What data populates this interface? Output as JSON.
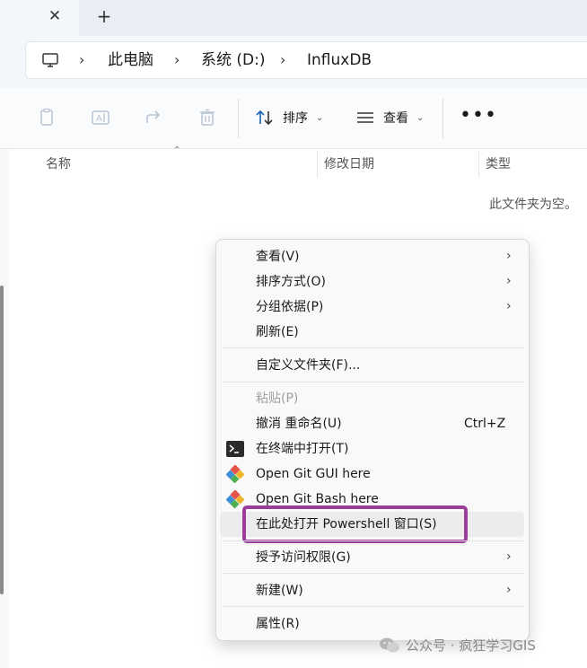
{
  "tabs": {
    "close_glyph": "✕",
    "new_tab_glyph": "+"
  },
  "address": {
    "icon": "this-pc-icon",
    "separator": "›",
    "crumbs": [
      "此电脑",
      "系统 (D:)",
      "InfluxDB"
    ]
  },
  "command_bar": {
    "icons": [
      "copy-icon",
      "rename-icon",
      "share-icon",
      "delete-icon"
    ],
    "sort_label": "排序",
    "view_label": "查看",
    "more_glyph": "•••",
    "caret": "⌄"
  },
  "columns": {
    "name": "名称",
    "modified": "修改日期",
    "type": "类型"
  },
  "empty_message": "此文件夹为空。",
  "context_menu": {
    "items": [
      {
        "label": "查看(V)",
        "submenu": true
      },
      {
        "label": "排序方式(O)",
        "submenu": true
      },
      {
        "label": "分组依据(P)",
        "submenu": true
      },
      {
        "label": "刷新(E)"
      },
      {
        "label": "自定义文件夹(F)..."
      },
      {
        "label": "粘贴(P)",
        "disabled": true
      },
      {
        "label": "撤消 重命名(U)",
        "shortcut": "Ctrl+Z"
      },
      {
        "label": "在终端中打开(T)",
        "icon": "terminal-icon"
      },
      {
        "label": "Open Git GUI here",
        "icon": "git-icon"
      },
      {
        "label": "Open Git Bash here",
        "icon": "git-icon"
      },
      {
        "label": "在此处打开 Powershell 窗口(S)",
        "highlighted": true
      },
      {
        "label": "授予访问权限(G)",
        "submenu": true
      },
      {
        "label": "新建(W)",
        "submenu": true
      },
      {
        "label": "属性(R)"
      }
    ],
    "submenu_arrow": "›",
    "highlight_color": "#9b3d9b"
  },
  "watermark": {
    "text": "公众号 · 疯狂学习GIS",
    "icon": "wechat-icon"
  }
}
